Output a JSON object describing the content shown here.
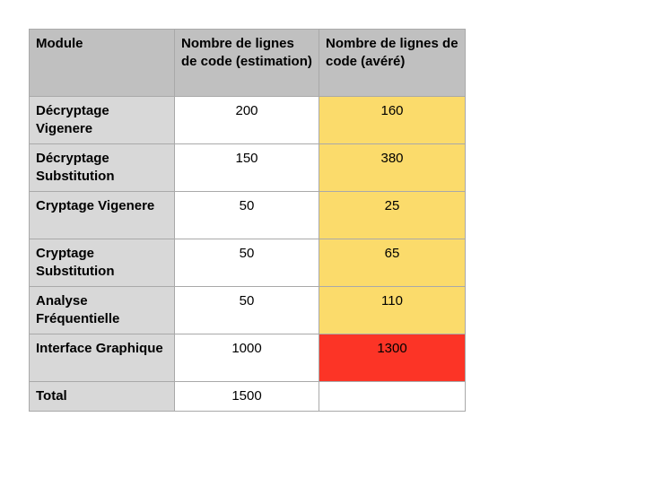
{
  "table": {
    "headers": [
      "Module",
      "Nombre de lignes de code (estimation)",
      "Nombre de lignes de code (avéré)"
    ],
    "rows": [
      {
        "module": "Décryptage Vigenere",
        "estimation": "200",
        "actual": "160",
        "highlight": "yellow"
      },
      {
        "module": "Décryptage Substitution",
        "estimation": "150",
        "actual": "380",
        "highlight": "yellow"
      },
      {
        "module": "Cryptage Vigenere",
        "estimation": "50",
        "actual": "25",
        "highlight": "yellow"
      },
      {
        "module": "Cryptage Substitution",
        "estimation": "50",
        "actual": "65",
        "highlight": "yellow"
      },
      {
        "module": "Analyse Fréquentielle",
        "estimation": "50",
        "actual": "110",
        "highlight": "yellow"
      },
      {
        "module": "Interface Graphique",
        "estimation": "1000",
        "actual": "1300",
        "highlight": "red"
      }
    ],
    "total": {
      "label": "Total",
      "estimation": "1500",
      "actual": ""
    }
  },
  "colors": {
    "header_bg": "#c0c0c0",
    "module_bg": "#d8d8d8",
    "yellow": "#fbdb6b",
    "red": "#fc3426",
    "border": "#a9a9a9"
  }
}
